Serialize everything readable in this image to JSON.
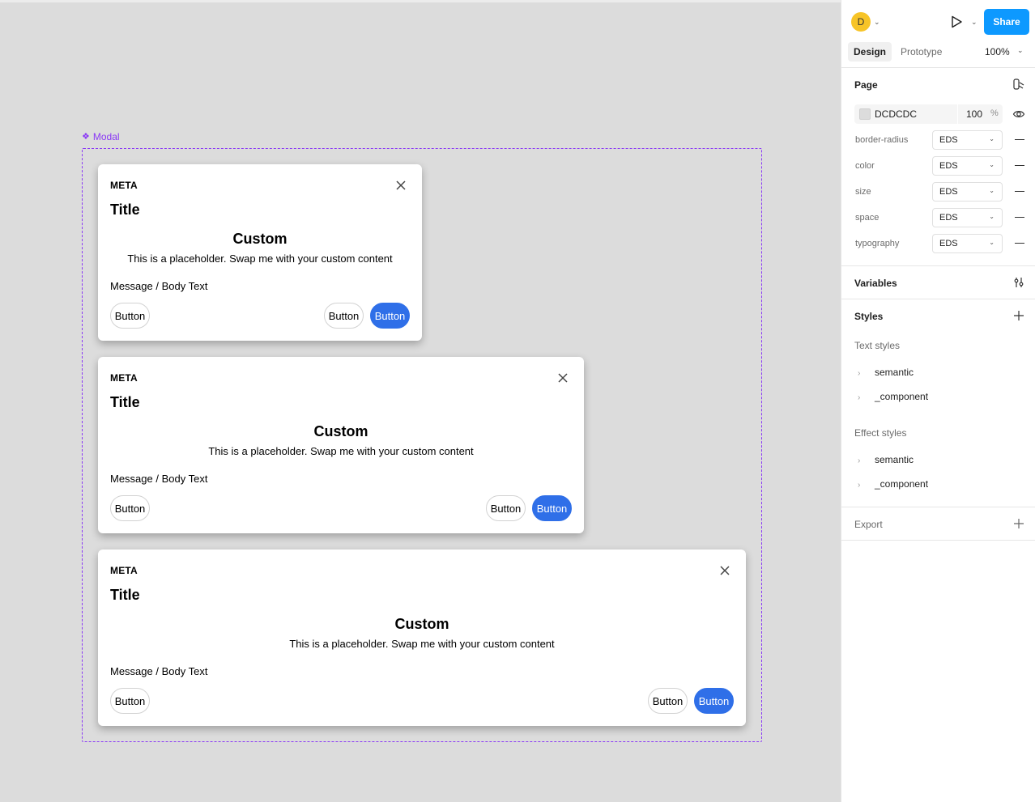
{
  "canvas": {
    "frame_label": "Modal",
    "modals": [
      {
        "meta": "META",
        "title": "Title",
        "custom_heading": "Custom",
        "custom_text": "This is a placeholder. Swap me with your custom content",
        "body_text": "Message / Body Text",
        "left_button": "Button",
        "secondary_button": "Button",
        "primary_button": "Button"
      },
      {
        "meta": "META",
        "title": "Title",
        "custom_heading": "Custom",
        "custom_text": "This is a placeholder. Swap me with your custom content",
        "body_text": "Message / Body Text",
        "left_button": "Button",
        "secondary_button": "Button",
        "primary_button": "Button"
      },
      {
        "meta": "META",
        "title": "Title",
        "custom_heading": "Custom",
        "custom_text": "This is a placeholder. Swap me with your custom content",
        "body_text": "Message / Body Text",
        "left_button": "Button",
        "secondary_button": "Button",
        "primary_button": "Button"
      }
    ]
  },
  "panel": {
    "user_initial": "D",
    "share_label": "Share",
    "tabs": [
      {
        "label": "Design",
        "active": true
      },
      {
        "label": "Prototype",
        "active": false
      }
    ],
    "zoom": "100%",
    "page": {
      "title": "Page",
      "bg_hex": "DCDCDC",
      "opacity": "100",
      "opacity_unit": "%",
      "variables": [
        {
          "label": "border-radius",
          "value": "EDS"
        },
        {
          "label": "color",
          "value": "EDS"
        },
        {
          "label": "size",
          "value": "EDS"
        },
        {
          "label": "space",
          "value": "EDS"
        },
        {
          "label": "typography",
          "value": "EDS"
        }
      ]
    },
    "variables_title": "Variables",
    "styles": {
      "title": "Styles",
      "text_styles_label": "Text styles",
      "text_styles": [
        "semantic",
        "_component"
      ],
      "effect_styles_label": "Effect styles",
      "effect_styles": [
        "semantic",
        "_component"
      ]
    },
    "export_title": "Export"
  },
  "colors": {
    "canvas_bg": "#dcdcdc",
    "component_purple": "#8a38f5",
    "primary_button": "#2f6fe8",
    "share_button": "#0d99ff",
    "avatar": "#f7c427"
  }
}
